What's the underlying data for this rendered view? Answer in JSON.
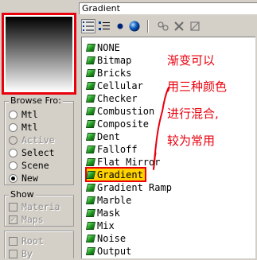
{
  "header": {
    "title": "Gradient"
  },
  "browse_from": {
    "title": "Browse Fro:",
    "options": [
      {
        "label": "Mtl",
        "checked": false,
        "enabled": true
      },
      {
        "label": "Mtl",
        "checked": false,
        "enabled": true
      },
      {
        "label": "Active",
        "checked": false,
        "enabled": false
      },
      {
        "label": "Select",
        "checked": false,
        "enabled": true
      },
      {
        "label": "Scene",
        "checked": false,
        "enabled": true
      },
      {
        "label": "New",
        "checked": true,
        "enabled": true
      }
    ]
  },
  "show": {
    "title": "Show",
    "options": [
      {
        "label": "Materia",
        "checked": false
      },
      {
        "label": "Maps",
        "checked": true
      }
    ]
  },
  "bottom_options": [
    {
      "label": "Root",
      "checked": false
    },
    {
      "label": "By",
      "checked": false
    }
  ],
  "toolbar": {
    "icons": [
      "list-view-icon",
      "small-icons-view-icon",
      "large-icons-view-icon",
      "sphere-view-icon",
      "update-scene-icon",
      "delete-icon",
      "clear-icon"
    ]
  },
  "maps": {
    "items": [
      "NONE",
      "Bitmap",
      "Bricks",
      "Cellular",
      "Checker",
      "Combustion",
      "Composite",
      "Dent",
      "Falloff",
      "Flat Mirror",
      "Gradient",
      "Gradient Ramp",
      "Marble",
      "Mask",
      "Mix",
      "Noise",
      "Output"
    ],
    "selected": "Gradient"
  },
  "annotation": {
    "lines": [
      "渐变可以",
      "用三种颜色",
      "进行混合,",
      "较为常用"
    ],
    "color": "#e8000c"
  },
  "colors": {
    "highlight": "#ffd200",
    "annotation_red": "#e8000c",
    "map_icon_green": "#1f9a1f"
  }
}
